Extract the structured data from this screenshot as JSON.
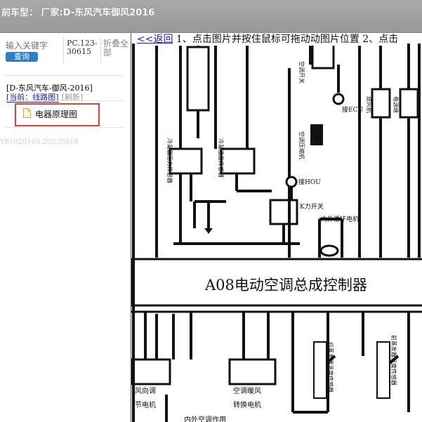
{
  "header": {
    "title": "前车型：  厂家:D-东风汽车御风2016"
  },
  "search": {
    "placeholder": "输入关键字",
    "button_label": "查询"
  },
  "toolbar": {
    "pc_label": "PC.123-30615",
    "fold_label": "折叠全部"
  },
  "breadcrumb": "[D-东风汽车-御风-2016]",
  "current": {
    "label": "[当前：线路图]",
    "refresh_label": "[刷新]"
  },
  "tree": {
    "items": [
      {
        "label": "电器原理图",
        "icon": "file-icon"
      }
    ]
  },
  "watermark": "Y81020165.20230818",
  "viewer": {
    "back_label": "<<返回",
    "instructions": " 1、点击图片并按住鼠标可拖动动图片位置 2、点击"
  },
  "diagram": {
    "controller_label": "A08电动空调总成控制器",
    "labels": {
      "ac_switch": "空调开关",
      "ground_ecu": "接ECU",
      "ac_compressor": "空调压缩机",
      "ground_hou": "接HOU",
      "pressure_switch": "K力开关",
      "inner_outer_motor": "内外循环电机",
      "evap_temp_sensor": "冷凝器压力传感器",
      "evap_temp_sensor2": "冷凝温度传感器",
      "blower_relay": "鼓风机",
      "power_relay": "电源继",
      "wind_motor_1": "风向调",
      "wind_motor_2": "节电机",
      "mix_motor_1": "空调暖风",
      "mix_motor_2": "转换电机",
      "rear_sensor": "后蒸发器温度传感器",
      "front_sensor": "前蒸发器温度传感器",
      "bottom_text": "内外空调作用"
    }
  },
  "colors": {
    "topbar": "#9e9e9e",
    "accent": "#2f7ec4",
    "highlight_box": "#d9413f",
    "link": "#1a1aa6"
  }
}
